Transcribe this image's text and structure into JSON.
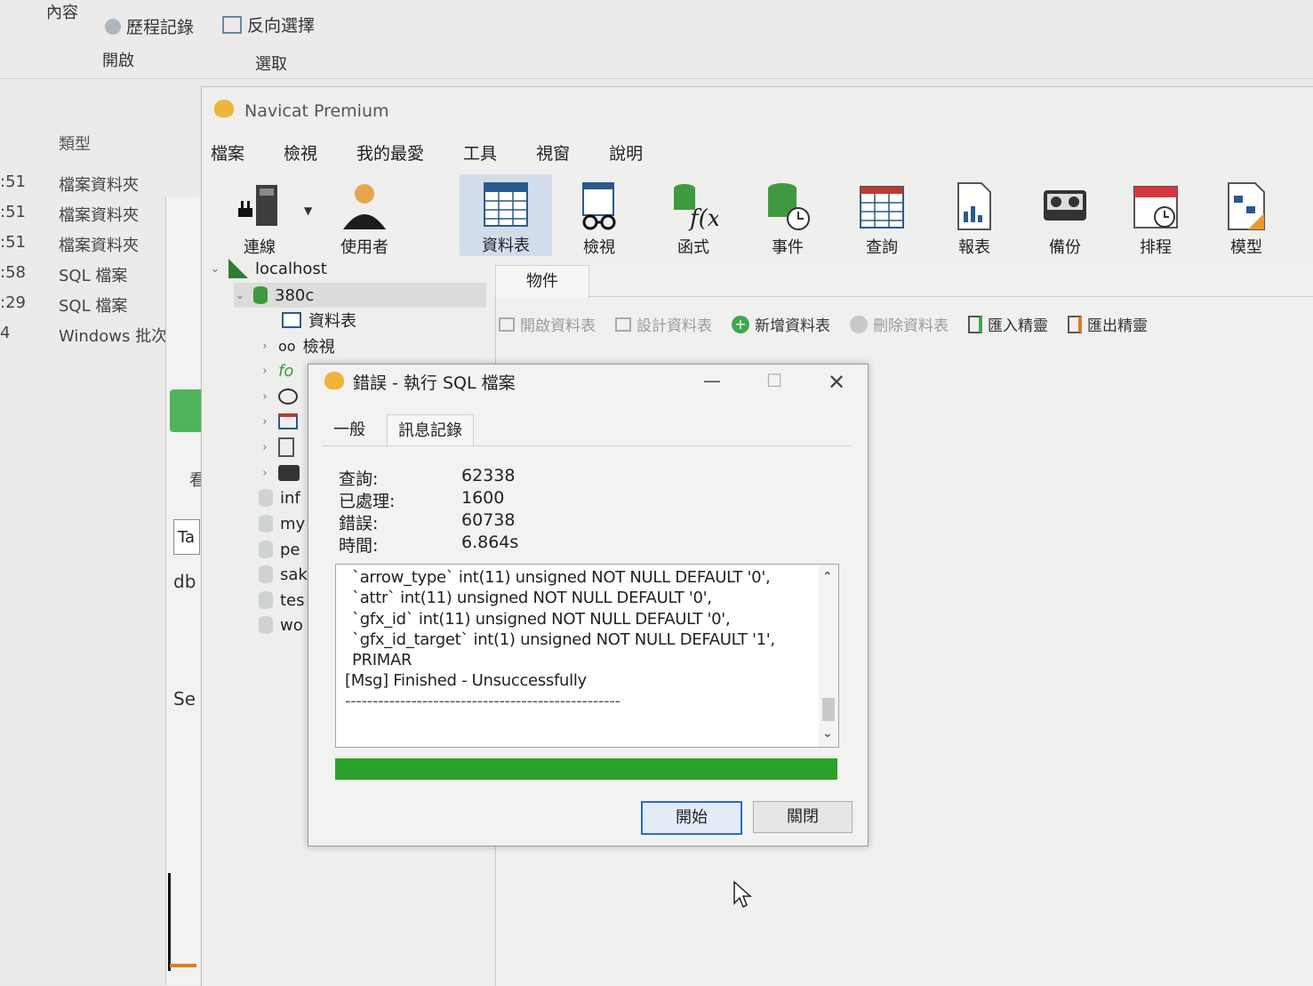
{
  "explorer": {
    "ribbon": {
      "content_label": "內容",
      "history_label": "歷程記錄",
      "invert_label": "反向選擇",
      "open_group": "開啟",
      "select_group": "選取"
    },
    "type_header": "類型",
    "rows": [
      {
        "time": ":51",
        "type": "檔案資料夾"
      },
      {
        "time": ":51",
        "type": "檔案資料夾"
      },
      {
        "time": ":51",
        "type": "檔案資料夾"
      },
      {
        "time": ":58",
        "type": "SQL 檔案"
      },
      {
        "time": ":29",
        "type": "SQL 檔案"
      },
      {
        "time": "4",
        "type": "Windows 批次"
      }
    ],
    "side": {
      "fragment1": "看",
      "fragment2": "Ta",
      "fragment3": "db",
      "fragment4": "Se"
    }
  },
  "navicat": {
    "title": "Navicat Premium",
    "menu": [
      "檔案",
      "檢視",
      "我的最愛",
      "工具",
      "視窗",
      "說明"
    ],
    "toolbar": [
      {
        "label": "連線",
        "icon": "connection-icon"
      },
      {
        "label": "使用者",
        "icon": "user-icon"
      },
      {
        "label": "資料表",
        "icon": "table-icon"
      },
      {
        "label": "檢視",
        "icon": "view-icon"
      },
      {
        "label": "函式",
        "icon": "function-icon"
      },
      {
        "label": "事件",
        "icon": "event-icon"
      },
      {
        "label": "查詢",
        "icon": "query-icon"
      },
      {
        "label": "報表",
        "icon": "report-icon"
      },
      {
        "label": "備份",
        "icon": "backup-icon"
      },
      {
        "label": "排程",
        "icon": "schedule-icon"
      },
      {
        "label": "模型",
        "icon": "model-icon"
      }
    ],
    "tree": {
      "connection": "localhost",
      "database": "380c",
      "tables": "資料表",
      "views": "檢視",
      "functions_fragment": "fo",
      "other_dbs": [
        "inf",
        "my",
        "pe",
        "sak",
        "tes",
        "wo"
      ]
    },
    "objects_tab": "物件",
    "object_actions": [
      "開啟資料表",
      "設計資料表",
      "新增資料表",
      "刪除資料表",
      "匯入精靈",
      "匯出精靈"
    ]
  },
  "dialog": {
    "title": "錯誤 - 執行 SQL 檔案",
    "tabs": [
      "一般",
      "訊息記錄"
    ],
    "stats": [
      {
        "label": "查詢:",
        "value": "62338"
      },
      {
        "label": "已處理:",
        "value": "1600"
      },
      {
        "label": "錯誤:",
        "value": "60738"
      },
      {
        "label": "時間:",
        "value": "6.864s"
      }
    ],
    "log": [
      "`arrow_type` int(11) unsigned NOT NULL DEFAULT '0',",
      "`attr` int(11) unsigned NOT NULL DEFAULT '0',",
      "`gfx_id` int(11) unsigned NOT NULL DEFAULT '0',",
      "`gfx_id_target` int(1) unsigned NOT NULL DEFAULT '1',",
      "PRIMAR",
      "[Msg] Finished - Unsuccessfully",
      "--------------------------------------------------"
    ],
    "progress": 1.0,
    "start_button": "開始",
    "close_button": "關閉",
    "accent": "#2ba12b"
  }
}
